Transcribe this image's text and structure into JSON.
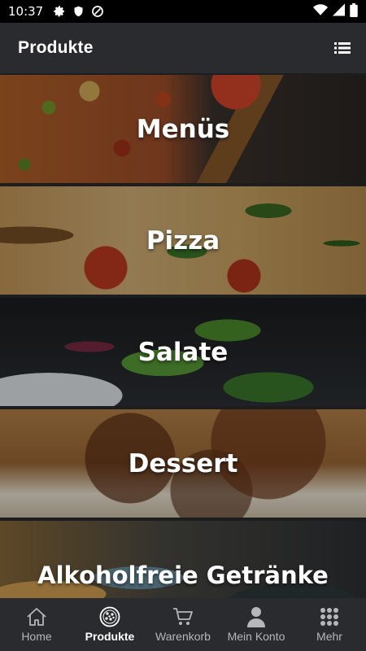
{
  "status_bar": {
    "time": "10:37",
    "left_icons": [
      "gear-icon",
      "shield-icon",
      "at-sign-icon"
    ],
    "right_icons": [
      "wifi-icon",
      "cell-signal-icon",
      "battery-icon"
    ]
  },
  "app_bar": {
    "title": "Produkte",
    "menu_icon": "list-view-icon"
  },
  "categories": [
    {
      "label": "Menüs"
    },
    {
      "label": "Pizza"
    },
    {
      "label": "Salate"
    },
    {
      "label": "Dessert"
    },
    {
      "label": "Alkoholfreie Getränke"
    }
  ],
  "bottom_nav": {
    "active": "Produkte",
    "items": [
      {
        "label": "Home",
        "icon": "home-icon"
      },
      {
        "label": "Produkte",
        "icon": "pizza-icon"
      },
      {
        "label": "Warenkorb",
        "icon": "cart-icon"
      },
      {
        "label": "Mein Konto",
        "icon": "person-icon"
      },
      {
        "label": "Mehr",
        "icon": "grid-dots-icon"
      }
    ]
  },
  "colors": {
    "app_bar": "#2a2b2e",
    "background": "#1c1d1f",
    "nav_inactive": "#b6b7ba",
    "nav_active": "#ffffff"
  }
}
